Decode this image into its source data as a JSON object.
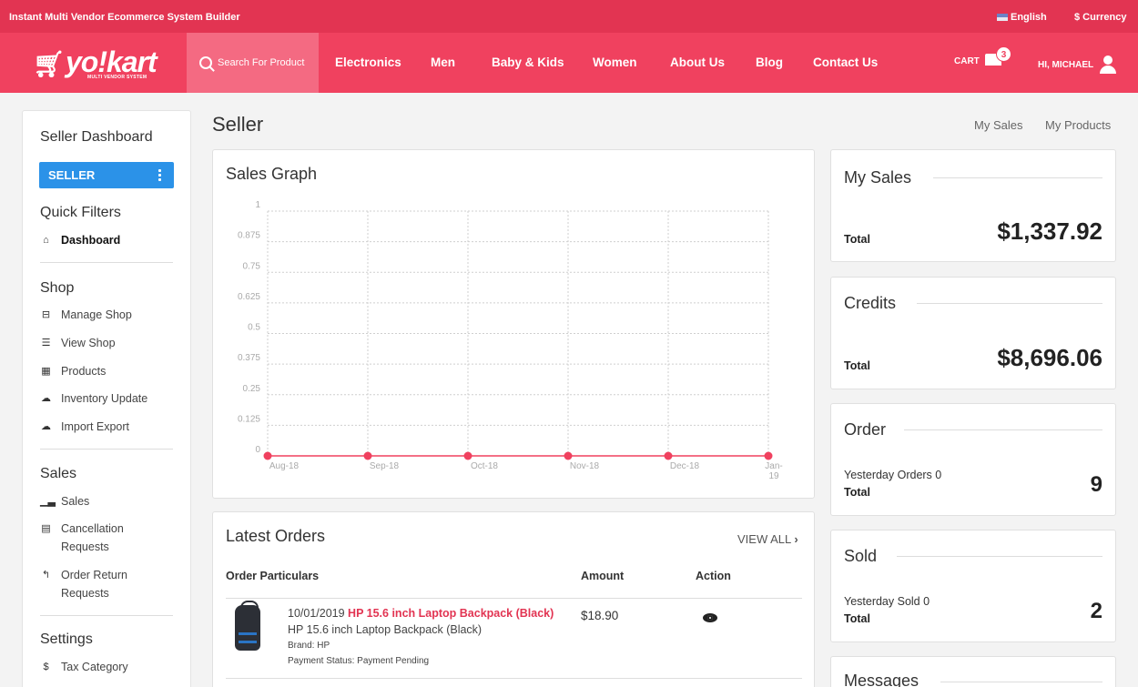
{
  "topbar": {
    "tagline": "Instant Multi Vendor Ecommerce System Builder",
    "language": "English",
    "currency": "$ Currency"
  },
  "header": {
    "logo_text": "yo!kart",
    "logo_sub": "MULTI VENDOR SYSTEM",
    "search_label": "Search For Product",
    "nav": [
      "Electronics",
      "Men",
      "Baby & Kids",
      "Women",
      "About Us",
      "Blog",
      "Contact Us"
    ],
    "cart_label": "CART",
    "cart_count": "3",
    "user_label": "HI, MICHAEL"
  },
  "sidebar": {
    "title": "Seller Dashboard",
    "role_button": "SELLER",
    "quick_filters": "Quick Filters",
    "dashboard": "Dashboard",
    "shop_title": "Shop",
    "shop_items": [
      "Manage Shop",
      "View Shop",
      "Products",
      "Inventory Update",
      "Import Export"
    ],
    "sales_title": "Sales",
    "sales_items": [
      "Sales",
      "Cancellation Requests",
      "Order Return Requests"
    ],
    "settings_title": "Settings",
    "settings_items": [
      "Tax Category"
    ]
  },
  "main": {
    "page_title": "Seller",
    "link_sales": "My Sales",
    "link_products": "My Products",
    "graph_title": "Sales Graph",
    "orders_title": "Latest Orders",
    "view_all": "VIEW ALL",
    "col_particulars": "Order Particulars",
    "col_amount": "Amount",
    "col_action": "Action",
    "order": {
      "date": "10/01/2019",
      "product_link": "HP 15.6 inch Laptop Backpack (Black)",
      "product_name": "HP 15.6 inch Laptop Backpack (Black)",
      "brand": "Brand: HP",
      "payment": "Payment Status: Payment Pending",
      "amount": "$18.90"
    }
  },
  "stats": {
    "my_sales": {
      "title": "My Sales",
      "total_label": "Total",
      "value": "$1,337.92"
    },
    "credits": {
      "title": "Credits",
      "total_label": "Total",
      "value": "$8,696.06"
    },
    "order": {
      "title": "Order",
      "sub_label": "Yesterday Orders 0",
      "total_label": "Total",
      "value": "9"
    },
    "sold": {
      "title": "Sold",
      "sub_label": "Yesterday Sold 0",
      "total_label": "Total",
      "value": "2"
    },
    "messages": {
      "title": "Messages"
    }
  },
  "colors": {
    "brand": "#f0415f",
    "topbar": "#e23452",
    "seller_button": "#2b92e8"
  },
  "chart_data": {
    "type": "line",
    "title": "Sales Graph",
    "categories": [
      "Aug-18",
      "Sep-18",
      "Oct-18",
      "Nov-18",
      "Dec-18",
      "Jan-19"
    ],
    "series": [
      {
        "values": [
          0,
          0,
          0,
          0,
          0,
          0
        ]
      }
    ],
    "ylim": [
      0,
      1
    ],
    "yticks": [
      "0",
      "0.125",
      "0.25",
      "0.375",
      "0.5",
      "0.625",
      "0.75",
      "0.875",
      "1"
    ],
    "grid": true,
    "line_color": "#f0415f"
  }
}
